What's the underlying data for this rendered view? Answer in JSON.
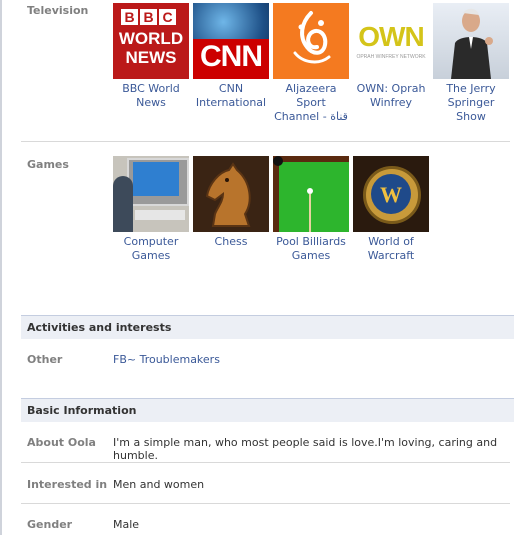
{
  "television": {
    "label": "Television",
    "items": [
      {
        "caption": "BBC World News",
        "logo_line1": "BBC",
        "logo_line2": "WORLD",
        "logo_line3": "NEWS"
      },
      {
        "caption": "CNN International",
        "logo": "CNN"
      },
      {
        "caption": "Aljazeera Sport Channel - قناة"
      },
      {
        "caption": "OWN: Oprah Winfrey",
        "logo": "OWN",
        "logo_sub": "OPRAH WINFREY NETWORK"
      },
      {
        "caption": "The Jerry Springer Show"
      }
    ]
  },
  "games": {
    "label": "Games",
    "items": [
      {
        "caption": "Computer Games"
      },
      {
        "caption": "Chess"
      },
      {
        "caption": "Pool Billiards Games"
      },
      {
        "caption": "World of Warcraft"
      }
    ]
  },
  "activities": {
    "header": "Activities and interests",
    "other_label": "Other",
    "other_value": "FB~ Troublemakers"
  },
  "basic": {
    "header": "Basic Information",
    "about_label": "About Oola",
    "about_value": "I'm a simple man, who most people said is love.I'm loving, caring and humble.",
    "interested_label": "Interested in",
    "interested_value": "Men and women",
    "gender_label": "Gender",
    "gender_value": "Male"
  },
  "colors": {
    "link": "#3b5998",
    "label": "#808080",
    "header_bg": "#eceff5"
  }
}
